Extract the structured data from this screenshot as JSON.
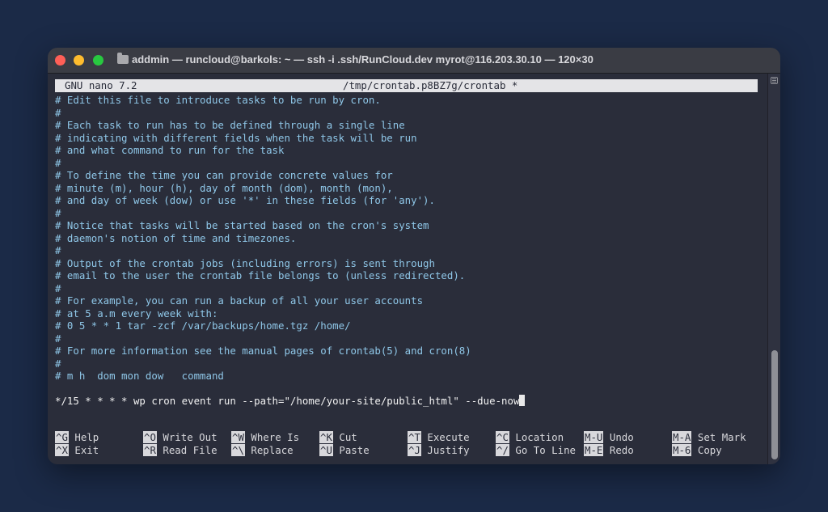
{
  "window": {
    "title": "addmin — runcloud@barkols: ~ — ssh -i .ssh/RunCloud.dev myrot@116.203.30.10 — 120×30"
  },
  "nano": {
    "app_version": "GNU nano 7.2",
    "file_path": "/tmp/crontab.p8BZ7g/crontab *"
  },
  "editor": {
    "lines": [
      "# Edit this file to introduce tasks to be run by cron.",
      "#",
      "# Each task to run has to be defined through a single line",
      "# indicating with different fields when the task will be run",
      "# and what command to run for the task",
      "#",
      "# To define the time you can provide concrete values for",
      "# minute (m), hour (h), day of month (dom), month (mon),",
      "# and day of week (dow) or use '*' in these fields (for 'any').",
      "#",
      "# Notice that tasks will be started based on the cron's system",
      "# daemon's notion of time and timezones.",
      "#",
      "# Output of the crontab jobs (including errors) is sent through",
      "# email to the user the crontab file belongs to (unless redirected).",
      "#",
      "# For example, you can run a backup of all your user accounts",
      "# at 5 a.m every week with:",
      "# 0 5 * * 1 tar -zcf /var/backups/home.tgz /home/",
      "#",
      "# For more information see the manual pages of crontab(5) and cron(8)",
      "#",
      "# m h  dom mon dow   command"
    ],
    "command_line": "*/15 * * * * wp cron event run --path=\"/home/your-site/public_html\" --due-now"
  },
  "shortcuts": [
    {
      "key": "^G",
      "label": "Help"
    },
    {
      "key": "^O",
      "label": "Write Out"
    },
    {
      "key": "^W",
      "label": "Where Is"
    },
    {
      "key": "^K",
      "label": "Cut"
    },
    {
      "key": "^T",
      "label": "Execute"
    },
    {
      "key": "^C",
      "label": "Location"
    },
    {
      "key": "M-U",
      "label": "Undo"
    },
    {
      "key": "M-A",
      "label": "Set Mark"
    },
    {
      "key": "^X",
      "label": "Exit"
    },
    {
      "key": "^R",
      "label": "Read File"
    },
    {
      "key": "^\\",
      "label": "Replace"
    },
    {
      "key": "^U",
      "label": "Paste"
    },
    {
      "key": "^J",
      "label": "Justify"
    },
    {
      "key": "^/",
      "label": "Go To Line"
    },
    {
      "key": "M-E",
      "label": "Redo"
    },
    {
      "key": "M-6",
      "label": "Copy"
    }
  ]
}
